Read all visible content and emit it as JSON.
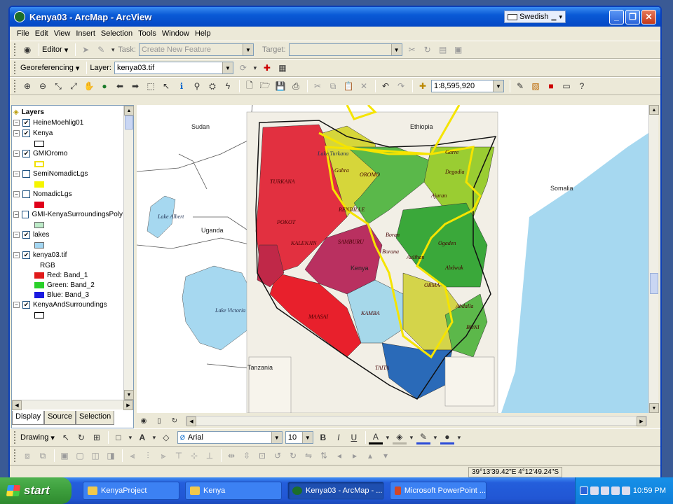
{
  "window": {
    "title": "Kenya03 - ArcMap - ArcView"
  },
  "langbar": {
    "language": "Swedish"
  },
  "menu": [
    "File",
    "Edit",
    "View",
    "Insert",
    "Selection",
    "Tools",
    "Window",
    "Help"
  ],
  "editor_toolbar": {
    "editor_label": "Editor",
    "task_label": "Task:",
    "task_value": "Create New Feature",
    "target_label": "Target:",
    "target_value": ""
  },
  "georef_toolbar": {
    "georef_label": "Georeferencing",
    "layer_label": "Layer:",
    "layer_value": "kenya03.tif"
  },
  "tools_toolbar": {
    "scale": "1:8,595,920"
  },
  "toc": {
    "root": "Layers",
    "layers": [
      {
        "name": "HeineMoehlig01",
        "checked": true,
        "legend": []
      },
      {
        "name": "Kenya",
        "checked": true,
        "legend": [
          {
            "color": "#ffffff",
            "border": "#000000",
            "label": ""
          }
        ]
      },
      {
        "name": "GMIOromo",
        "checked": true,
        "legend": [
          {
            "color": "#ffffff",
            "border": "#f0e000",
            "label": ""
          }
        ]
      },
      {
        "name": "SemiNomadicLgs",
        "checked": false,
        "legend": [
          {
            "color": "#f5f500",
            "border": "#f5f500",
            "label": ""
          }
        ]
      },
      {
        "name": "NomadicLgs",
        "checked": false,
        "legend": [
          {
            "color": "#e0001a",
            "border": "#e0001a",
            "label": ""
          }
        ]
      },
      {
        "name": "GMI-KenyaSurroundingsPoly",
        "checked": false,
        "legend": [
          {
            "color": "#bdebc8",
            "border": "#666666",
            "label": ""
          }
        ]
      },
      {
        "name": "lakes",
        "checked": true,
        "legend": [
          {
            "color": "#a3d6f2",
            "border": "#666666",
            "label": ""
          }
        ]
      },
      {
        "name": "kenya03.tif",
        "checked": true,
        "legend_title": "RGB",
        "legend": [
          {
            "color": "#e01a1a",
            "border": "#e01a1a",
            "label": "Red:   Band_1"
          },
          {
            "color": "#2ad02a",
            "border": "#2ad02a",
            "label": "Green: Band_2"
          },
          {
            "color": "#1a1ae0",
            "border": "#1a1ae0",
            "label": "Blue:  Band_3"
          }
        ]
      },
      {
        "name": "KenyaAndSurroundings",
        "checked": true,
        "legend": [
          {
            "color": "#ffffff",
            "border": "#000000",
            "label": ""
          }
        ]
      }
    ],
    "tabs": [
      "Display",
      "Source",
      "Selection"
    ]
  },
  "map": {
    "countries": [
      "Sudan",
      "Ethiopia",
      "Somalia",
      "Uganda",
      "Tanzania",
      "Kenya"
    ],
    "water": [
      "Lake Turkana",
      "Lake Albert",
      "Lake Victoria"
    ],
    "regions": [
      "TURKANA",
      "Gabra",
      "OROMO",
      "RENDILLE",
      "SAMBURU",
      "POKOT",
      "KALENJIN",
      "MAASAI",
      "KAMBA",
      "Borana",
      "Ogaden",
      "Garre",
      "Degodia",
      "Ajuran",
      "Abdwak",
      "Abdalla",
      "ORMA",
      "BONI",
      "TAITA",
      "Aulihan",
      "Boran"
    ]
  },
  "drawing_toolbar": {
    "drawing_label": "Drawing",
    "font": "Arial",
    "size": "10"
  },
  "status": {
    "coords": "39°13'39.42\"E  4°12'49.24\"S"
  },
  "taskbar": {
    "start": "start",
    "tasks": [
      {
        "label": "KenyaProject",
        "active": false
      },
      {
        "label": "Kenya",
        "active": false
      },
      {
        "label": "Kenya03 - ArcMap - ...",
        "active": true
      },
      {
        "label": "Microsoft PowerPoint ...",
        "active": false
      }
    ],
    "clock": "10:59 PM"
  }
}
